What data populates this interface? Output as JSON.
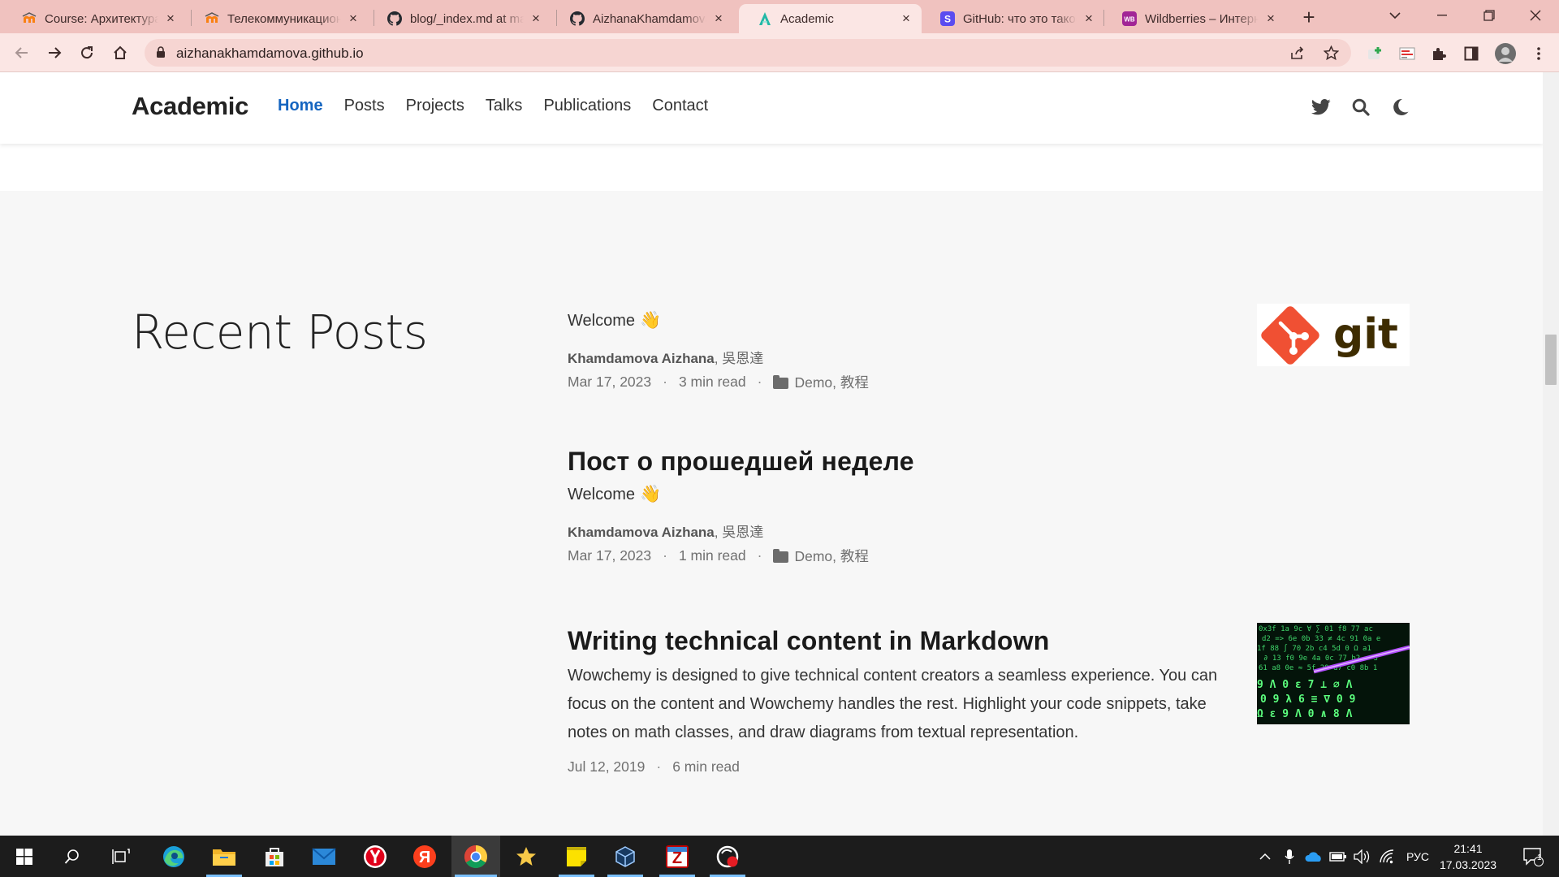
{
  "browser": {
    "tabs": [
      {
        "title": "Course: Архитектура информационных систем",
        "favicon": "moodle-icon",
        "active": false
      },
      {
        "title": "Телекоммуникационные технологии",
        "favicon": "moodle-icon",
        "active": false
      },
      {
        "title": "blog/_index.md at main",
        "favicon": "github-icon",
        "active": false
      },
      {
        "title": "AizhanaKhamdamova",
        "favicon": "github-icon",
        "active": false
      },
      {
        "title": "Academic",
        "favicon": "academic-icon",
        "active": true
      },
      {
        "title": "GitHub: что это такое",
        "favicon": "s-icon",
        "active": false
      },
      {
        "title": "Wildberries – Интернет-магазин",
        "favicon": "wb-icon",
        "active": false
      }
    ],
    "url": "aizhanakhamdamova.github.io",
    "colors": {
      "tabbar": "#f0c2bf",
      "toolbar": "#fbe6e4"
    }
  },
  "site": {
    "brand": "Academic",
    "nav": [
      {
        "label": "Home",
        "active": true
      },
      {
        "label": "Posts",
        "active": false
      },
      {
        "label": "Projects",
        "active": false
      },
      {
        "label": "Talks",
        "active": false
      },
      {
        "label": "Publications",
        "active": false
      },
      {
        "label": "Contact",
        "active": false
      }
    ],
    "header_icons": [
      "twitter-icon",
      "search-icon",
      "moon-icon"
    ],
    "accent": "#1565c0"
  },
  "section": {
    "title": "Recent Posts"
  },
  "posts": [
    {
      "title": "",
      "summary": "Welcome",
      "summary_emoji": "👋",
      "author_bold": "Khamdamova Aizhana",
      "author_rest": ", 吳恩達",
      "date": "Mar 17, 2023",
      "read_time": "3 min read",
      "categories": "Demo, 教程",
      "thumbnail": "git-logo"
    },
    {
      "title": "Пост о прошедшей неделе",
      "summary": "Welcome",
      "summary_emoji": "👋",
      "author_bold": "Khamdamova Aizhana",
      "author_rest": ", 吳恩達",
      "date": "Mar 17, 2023",
      "read_time": "1 min read",
      "categories": "Demo, 教程",
      "thumbnail": ""
    },
    {
      "title": "Writing technical content in Markdown",
      "summary": "Wowchemy is designed to give technical content creators a seamless experience. You can focus on the content and Wowchemy handles the rest. Highlight your code snippets, take notes on math classes, and draw diagrams from textual representation.",
      "date": "Jul 12, 2019",
      "read_time": "6 min read",
      "thumbnail": "code-matrix-image"
    }
  ],
  "taskbar": {
    "apps": [
      "windows-start-icon",
      "search-icon",
      "task-view-icon",
      "edge-icon",
      "file-explorer-icon",
      "store-icon",
      "mail-icon",
      "yandex-browser-icon",
      "yandex-icon",
      "chrome-icon",
      "star-app-icon",
      "sticky-notes-icon",
      "virtualbox-icon",
      "filezilla-icon",
      "opera-icon"
    ],
    "language": "РУС",
    "time": "21:41",
    "date": "17.03.2023",
    "notification_count": "1"
  }
}
